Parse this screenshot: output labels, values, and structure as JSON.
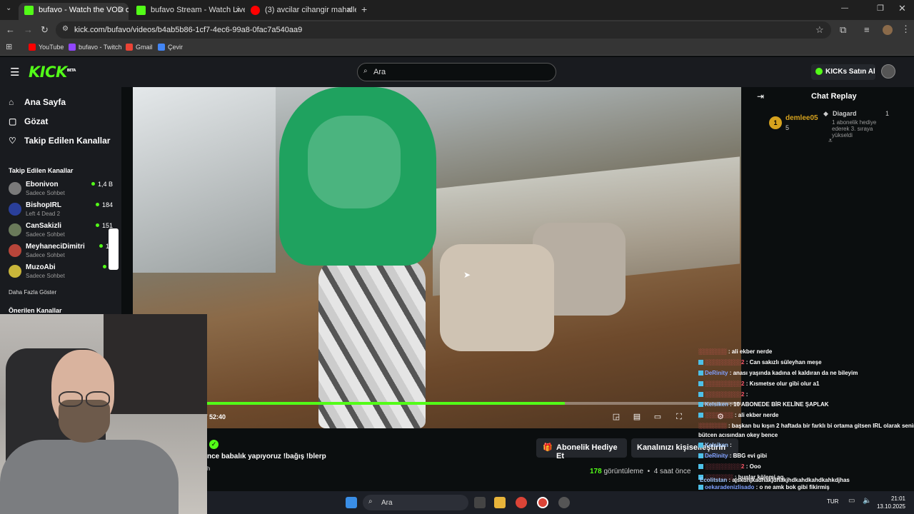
{
  "browser": {
    "tabs": [
      {
        "title": "bufavo - Watch the VOD on",
        "active": true
      },
      {
        "title": "bufavo Stream - Watch Live on",
        "active": false
      },
      {
        "title": "(3) avcilar cihangir mahallesi tü",
        "active": false
      }
    ],
    "url": "kick.com/bufavo/videos/b4ab5b86-1cf7-4ec6-99a8-0fac7a540aa9",
    "bookmarks": [
      "YouTube",
      "bufavo - Twitch",
      "Gmail",
      "Çevir"
    ]
  },
  "kick": {
    "logo": "KICK",
    "logo_sup": "BETA",
    "search_placeholder": "Ara",
    "kicks_button": "KICKs Satın Al",
    "accent": "#53fc18"
  },
  "sidebar": {
    "nav": [
      {
        "label": "Ana Sayfa",
        "icon": "home-icon"
      },
      {
        "label": "Gözat",
        "icon": "browse-icon"
      },
      {
        "label": "Takip Edilen Kanallar",
        "icon": "heart-icon"
      }
    ],
    "following_header": "Takip Edilen Kanallar",
    "following": [
      {
        "name": "Ebonivon",
        "category": "Sadece Sohbet",
        "viewers": "1,4 B"
      },
      {
        "name": "BishopIRL",
        "category": "Left 4 Dead 2",
        "viewers": "184"
      },
      {
        "name": "CanSakizli",
        "category": "Sadece Sohbet",
        "viewers": "151"
      },
      {
        "name": "MeyhaneciDimitri",
        "category": "Sadece Sohbet",
        "viewers": "12"
      },
      {
        "name": "MuzoAbi",
        "category": "Sadece Sohbet",
        "viewers": "8"
      }
    ],
    "show_more": "Daha Fazla Göster",
    "recommended_header": "Önerilen Kanallar"
  },
  "player": {
    "time": "/ 52:40",
    "progress": 0.67
  },
  "below": {
    "title": "nce babalık yapıyoruz !bağış !blerp",
    "gift_button": "Abonelik Hediye Et",
    "custom_button": "Kanalınızı kişiselleştirin",
    "views_count": "178",
    "views_label": "görüntüleme",
    "ago": "4 saat önce",
    "small": "h"
  },
  "chat": {
    "title": "Chat Replay",
    "top_gifter": {
      "rank": "1",
      "name": "demlee05",
      "count": "5"
    },
    "event": {
      "name": "Diagard",
      "count": "1",
      "text": "1 abonelik hediye ederek 3. sıraya yükseldi"
    }
  },
  "overlay_chat": [
    {
      "user": "",
      "text": ": ali ekber nerde"
    },
    {
      "user": "",
      "text": ": Can sakızlı süleyhan meşe"
    },
    {
      "user": "DeRinity",
      "text": ": anası yaşında kadına el kaldıran da ne bileyim"
    },
    {
      "user": "",
      "text": ": Kısmetse olur gibi olur a1"
    },
    {
      "user": "",
      "text": ":"
    },
    {
      "user": "Kelsiken",
      "text": ": 10 ABONEDE BİR KELİNE ŞAPLAK"
    },
    {
      "user": "",
      "text": ": ali ekber nerde"
    },
    {
      "user": "",
      "text": ": başkan bu kışın 2 haftada bir farklı bi ortama gitsen IRL olarak senin"
    },
    {
      "user": "",
      "text": "bütcen acısından okey bence"
    },
    {
      "user": "Kelsiken",
      "text": ":"
    },
    {
      "user": "DeRinity",
      "text": ": BBG evi gibi"
    },
    {
      "user": "",
      "text": ": Ooo"
    },
    {
      "user": "",
      "text": ": bunlar kölemi aq"
    },
    {
      "user": "oekaradenizlisado",
      "text": ": o ne amk bok gibi fikirmiş"
    },
    {
      "user": "Ecolitstan",
      "text": ": ajskdhjkadhakjdhakjhdkahdkahdkahkdjhas"
    }
  ],
  "taskbar": {
    "search": "Ara",
    "lang": "TUR",
    "time": "21:01",
    "date": "13.10.2025"
  }
}
